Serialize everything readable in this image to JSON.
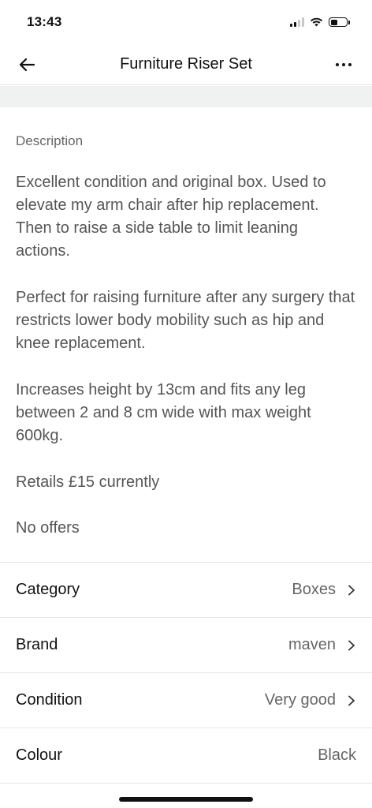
{
  "status_bar": {
    "time": "13:43",
    "battery_level": 0.45
  },
  "nav": {
    "title": "Furniture Riser Set",
    "back_icon": "arrow-left-icon",
    "more_icon": "more-dots-icon"
  },
  "description": {
    "heading": "Description",
    "paragraphs": [
      "Excellent condition and original box. Used to elevate my arm chair after hip replacement. Then to raise a side table to limit leaning actions.",
      "Perfect for raising furniture after any surgery that restricts lower body mobility such as hip and knee replacement.",
      "Increases height by 13cm and fits any leg between 2 and 8 cm wide with max weight 600kg.",
      "Retails £15 currently",
      "No offers"
    ]
  },
  "attributes": [
    {
      "label": "Category",
      "value": "Boxes"
    },
    {
      "label": "Brand",
      "value": "maven"
    },
    {
      "label": "Condition",
      "value": "Very good"
    },
    {
      "label": "Colour",
      "value": "Black"
    }
  ],
  "colors": {
    "text_primary": "#111111",
    "text_secondary": "#666666",
    "divider": "#e6e6e6",
    "band": "#f0f2f2"
  }
}
